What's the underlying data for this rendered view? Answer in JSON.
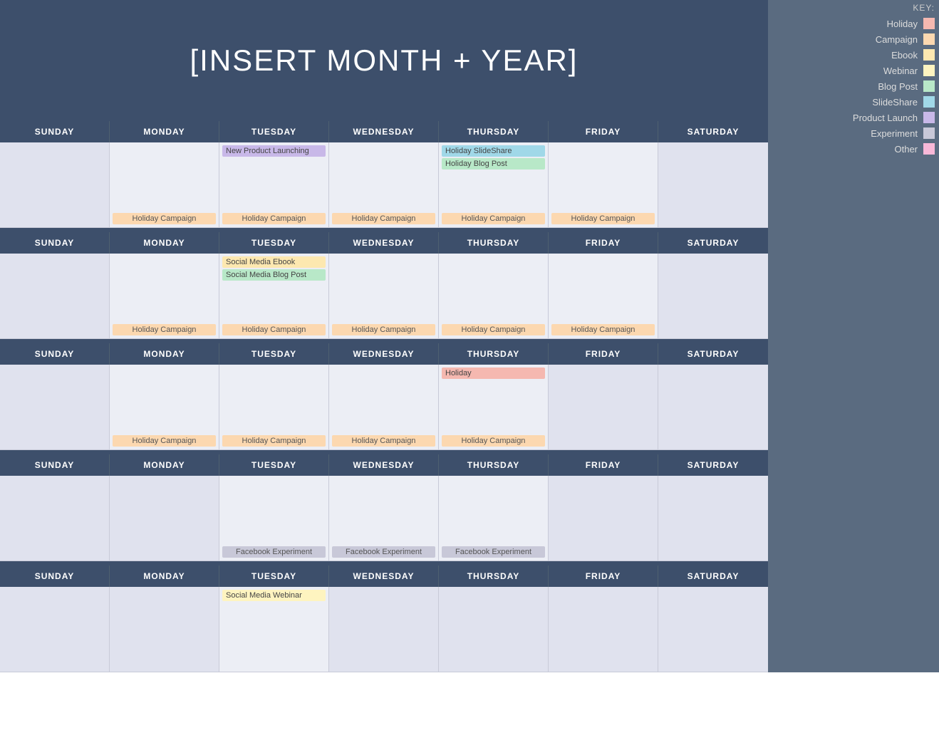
{
  "header": {
    "title": "[INSERT MONTH + YEAR]"
  },
  "legend": {
    "key_label": "KEY:",
    "items": [
      {
        "label": "Holiday",
        "color": "#f5b8b0"
      },
      {
        "label": "Campaign",
        "color": "#fcd8b0"
      },
      {
        "label": "Ebook",
        "color": "#fde8b0"
      },
      {
        "label": "Webinar",
        "color": "#fef4c0"
      },
      {
        "label": "Blog Post",
        "color": "#b8e8c8"
      },
      {
        "label": "SlideShare",
        "color": "#a0d8e8"
      },
      {
        "label": "Product Launch",
        "color": "#c8b8e8"
      },
      {
        "label": "Experiment",
        "color": "#c8c8d8"
      },
      {
        "label": "Other",
        "color": "#f8b8d8"
      }
    ]
  },
  "days": {
    "headers": [
      "SUNDAY",
      "MONDAY",
      "TUESDAY",
      "WEDNESDAY",
      "THURSDAY",
      "FRIDAY",
      "SATURDAY"
    ]
  },
  "weeks": [
    {
      "days": [
        {
          "events": [],
          "bottom": ""
        },
        {
          "events": [],
          "bottom": "Holiday Campaign"
        },
        {
          "events": [
            "New Product Launching"
          ],
          "bottom": "Holiday Campaign",
          "eventColors": [
            "productlaunch"
          ]
        },
        {
          "events": [],
          "bottom": "Holiday Campaign"
        },
        {
          "events": [
            "Holiday SlideShare",
            "Holiday Blog Post"
          ],
          "bottom": "Holiday Campaign",
          "eventColors": [
            "slideshare",
            "blogpost"
          ]
        },
        {
          "events": [],
          "bottom": "Holiday Campaign"
        },
        {
          "events": [],
          "bottom": ""
        }
      ]
    },
    {
      "days": [
        {
          "events": [],
          "bottom": ""
        },
        {
          "events": [],
          "bottom": "Holiday Campaign"
        },
        {
          "events": [
            "Social Media Ebook",
            "Social Media Blog Post"
          ],
          "bottom": "Holiday Campaign",
          "eventColors": [
            "ebook",
            "blogpost"
          ]
        },
        {
          "events": [],
          "bottom": "Holiday Campaign"
        },
        {
          "events": [],
          "bottom": "Holiday Campaign"
        },
        {
          "events": [],
          "bottom": "Holiday Campaign"
        },
        {
          "events": [],
          "bottom": ""
        }
      ]
    },
    {
      "days": [
        {
          "events": [],
          "bottom": ""
        },
        {
          "events": [],
          "bottom": "Holiday Campaign"
        },
        {
          "events": [],
          "bottom": "Holiday Campaign"
        },
        {
          "events": [],
          "bottom": "Holiday Campaign"
        },
        {
          "events": [
            "Holiday"
          ],
          "bottom": "Holiday Campaign",
          "eventColors": [
            "holiday"
          ]
        },
        {
          "events": [],
          "bottom": ""
        },
        {
          "events": [],
          "bottom": ""
        }
      ]
    },
    {
      "days": [
        {
          "events": [],
          "bottom": ""
        },
        {
          "events": [],
          "bottom": ""
        },
        {
          "events": [],
          "bottom": "Facebook Experiment",
          "bottomColor": "experiment"
        },
        {
          "events": [],
          "bottom": "Facebook Experiment",
          "bottomColor": "experiment"
        },
        {
          "events": [],
          "bottom": "Facebook Experiment",
          "bottomColor": "experiment"
        },
        {
          "events": [],
          "bottom": ""
        },
        {
          "events": [],
          "bottom": ""
        }
      ]
    },
    {
      "days": [
        {
          "events": [],
          "bottom": ""
        },
        {
          "events": [],
          "bottom": ""
        },
        {
          "events": [
            "Social Media Webinar"
          ],
          "bottom": "",
          "eventColors": [
            "webinar"
          ]
        },
        {
          "events": [],
          "bottom": ""
        },
        {
          "events": [],
          "bottom": ""
        },
        {
          "events": [],
          "bottom": ""
        },
        {
          "events": [],
          "bottom": ""
        }
      ]
    }
  ],
  "eventColorMap": {
    "holiday": "#f5b8b0",
    "campaign": "#fcd8b0",
    "ebook": "#fde8b0",
    "webinar": "#fef4c0",
    "blogpost": "#b8e8c8",
    "slideshare": "#a0d8e8",
    "productlaunch": "#c8b8e8",
    "experiment": "#c8c8d8",
    "other": "#f8b8d8"
  }
}
